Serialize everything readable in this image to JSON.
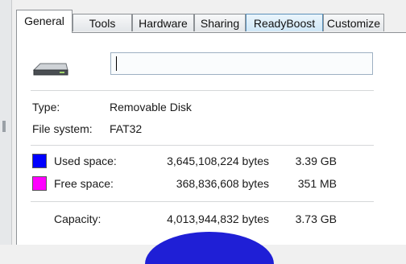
{
  "tabs": [
    {
      "label": "General",
      "active": true
    },
    {
      "label": "Tools"
    },
    {
      "label": "Hardware"
    },
    {
      "label": "Sharing"
    },
    {
      "label": "ReadyBoost",
      "hover": true
    },
    {
      "label": "Customize"
    }
  ],
  "drive": {
    "icon": "removable-drive-icon",
    "name_value": ""
  },
  "info": {
    "type_label": "Type:",
    "type_value": "Removable Disk",
    "fs_label": "File system:",
    "fs_value": "FAT32"
  },
  "space": {
    "used": {
      "label": "Used space:",
      "bytes": "3,645,108,224 bytes",
      "size": "3.39 GB",
      "color": "#0000ff"
    },
    "free": {
      "label": "Free space:",
      "bytes": "368,836,608 bytes",
      "size": "351 MB",
      "color": "#ff00ff"
    },
    "capacity": {
      "label": "Capacity:",
      "bytes": "4,013,944,832 bytes",
      "size": "3.73 GB"
    }
  },
  "colors": {
    "used": "#0000ff",
    "free": "#ff00ff",
    "pie": "#1f1fd6"
  }
}
